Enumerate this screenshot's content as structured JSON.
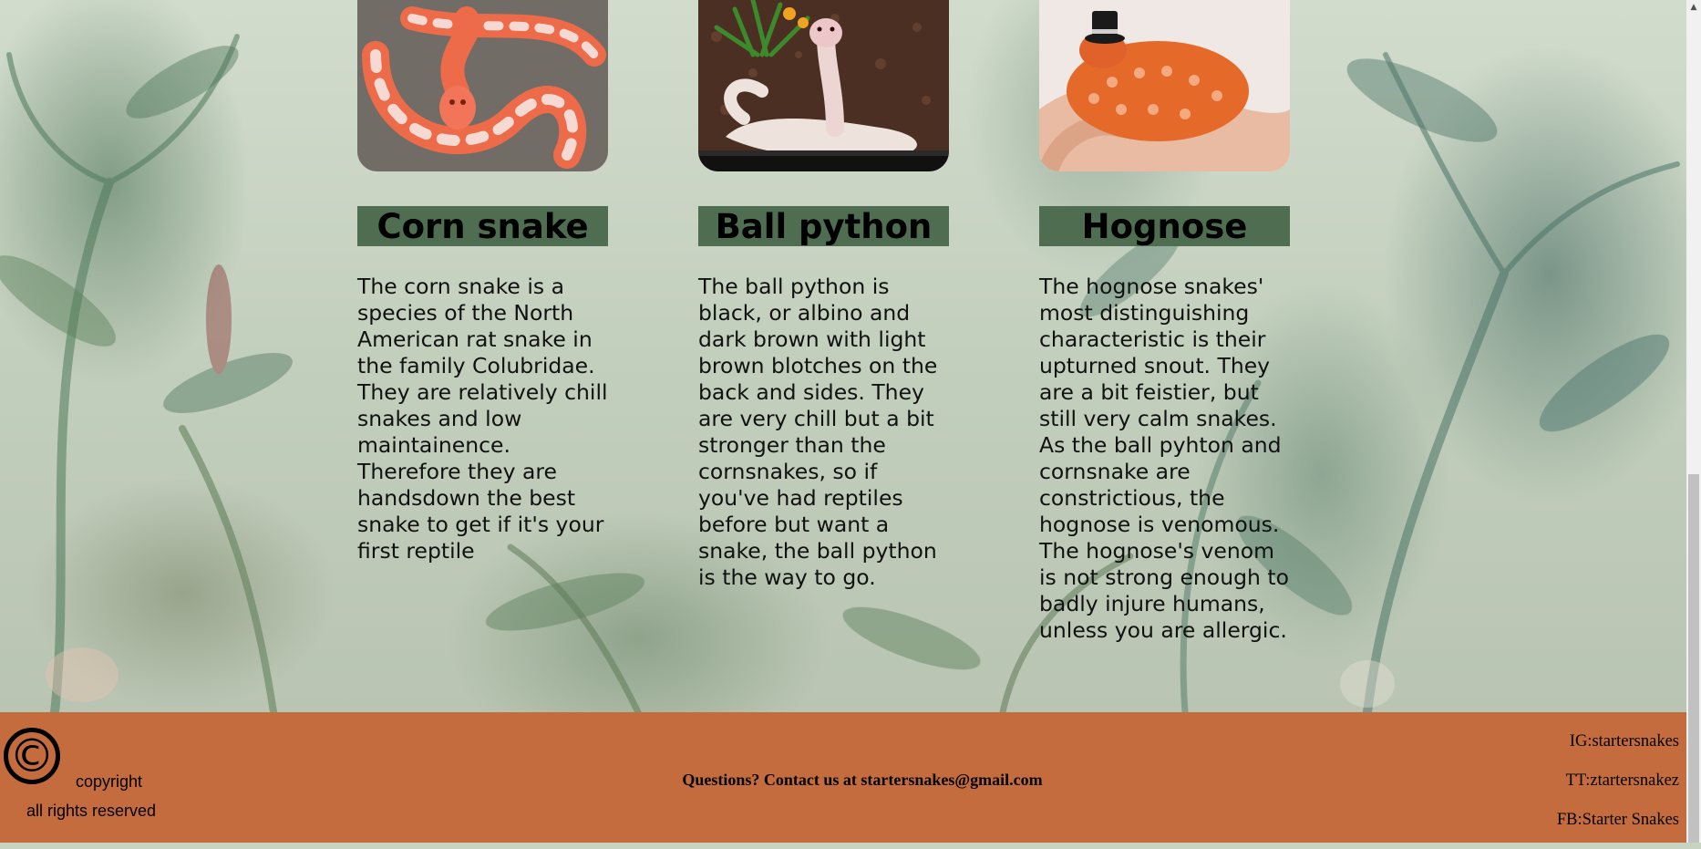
{
  "cards": [
    {
      "name": "Corn snake",
      "description": "The corn snake is a species of the North American rat snake in the family Colubridae. They are relatively chill snakes and low maintainence. Therefore they are handsdown the best snake to get if it's your first reptile",
      "image": "corn-snake-photo"
    },
    {
      "name": "Ball python",
      "description": "The ball python is black, or albino and dark brown with light brown blotches on the back and sides. They are very chill but a bit stronger than the cornsnakes, so if you've had reptiles before but want a snake, the ball python is the way to go.",
      "image": "ball-python-photo"
    },
    {
      "name": "Hognose",
      "description": "The hognose snakes' most distinguishing characteristic is their upturned snout. They are a bit feistier, but still very calm snakes. As the ball pyhton and cornsnake are constrictious, the hognose is venomous. The hognose's venom is not strong enough to badly injure humans, unless you are allergic.",
      "image": "hognose-photo"
    }
  ],
  "footer": {
    "copyright_symbol": "©",
    "copyright": "copyright",
    "rights": "all rights reserved",
    "contact": "Questions? Contact us at startersnakes@gmail.com",
    "social": [
      "IG:startersnakes",
      "TT:ztartersnakez",
      "FB:Starter Snakes"
    ]
  },
  "colors": {
    "footer_bg": "#c46c3d",
    "title_bg": "#4f6e51"
  }
}
